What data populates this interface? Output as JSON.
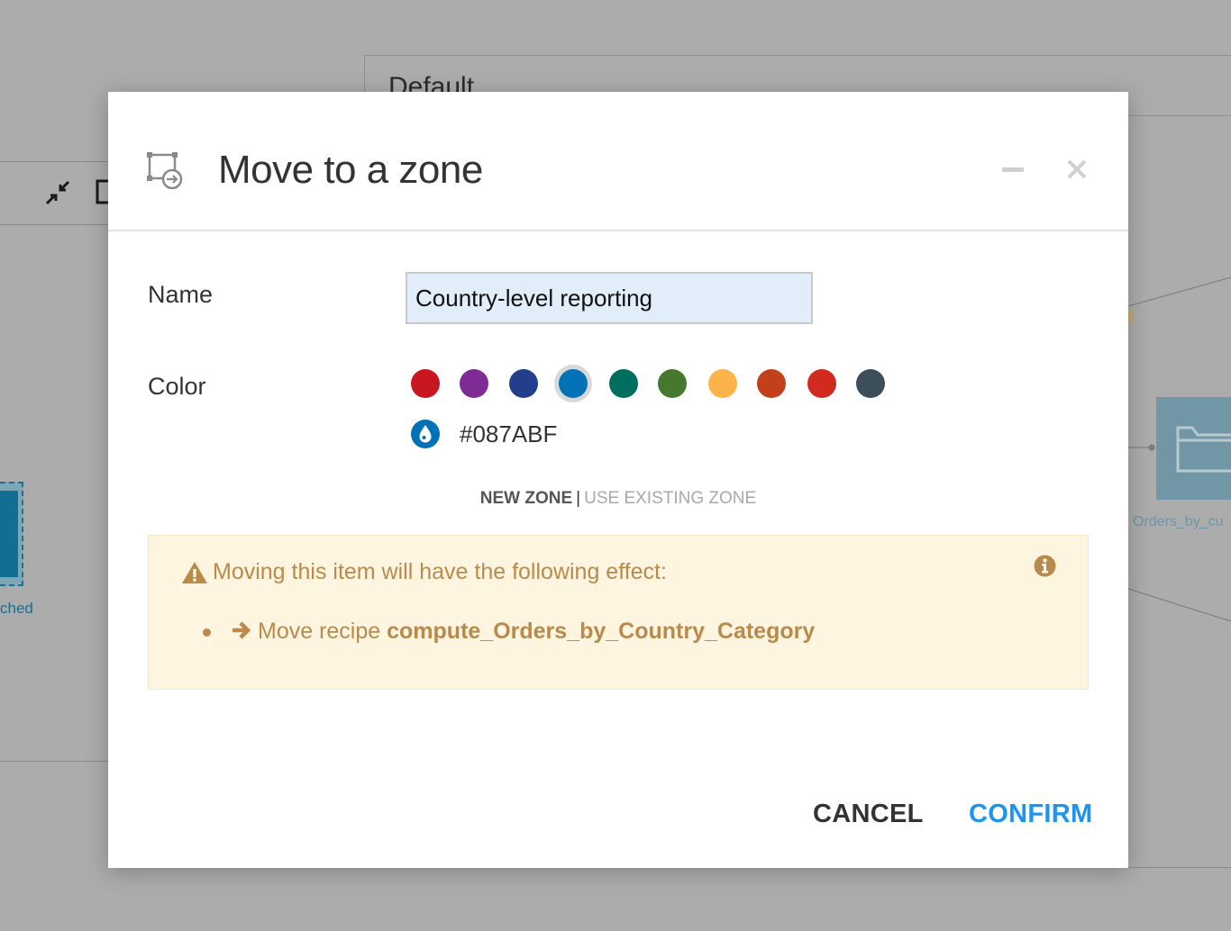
{
  "background": {
    "zone_title": "Default",
    "left_node_label": "ched",
    "right_node_label": "Orders_by_cu"
  },
  "modal": {
    "title": "Move to a zone",
    "title_icon": "zone-move-icon",
    "minimize_icon": "minimize-icon",
    "close_icon": "close-icon",
    "name_label": "Name",
    "name_value": "Country-level reporting",
    "color_label": "Color",
    "swatches": [
      {
        "color": "#C8171E",
        "selected": false
      },
      {
        "color": "#7E2B96",
        "selected": false
      },
      {
        "color": "#223E8C",
        "selected": false
      },
      {
        "color": "#0272B6",
        "selected": true
      },
      {
        "color": "#006E5E",
        "selected": false
      },
      {
        "color": "#46782D",
        "selected": false
      },
      {
        "color": "#FCB349",
        "selected": false
      },
      {
        "color": "#C2411A",
        "selected": false
      },
      {
        "color": "#D12A1E",
        "selected": false
      },
      {
        "color": "#3B4E59",
        "selected": false
      }
    ],
    "custom_color_icon": "color-drop-icon",
    "hex_value": "#087ABF",
    "tabs": {
      "new_zone": "NEW ZONE",
      "separator": "|",
      "use_existing": "USE EXISTING ZONE",
      "active": "new_zone"
    },
    "effect": {
      "title": "Moving this item will have the following effect:",
      "items": [
        {
          "action": "Move recipe ",
          "target": "compute_Orders_by_Country_Category"
        }
      ]
    },
    "buttons": {
      "cancel": "CANCEL",
      "confirm": "CONFIRM"
    },
    "colors": {
      "accent": "#1C94F0",
      "warning_text": "#B98A4C",
      "warning_bg": "#FDF5E0",
      "input_bg": "#E2EDFA"
    }
  }
}
